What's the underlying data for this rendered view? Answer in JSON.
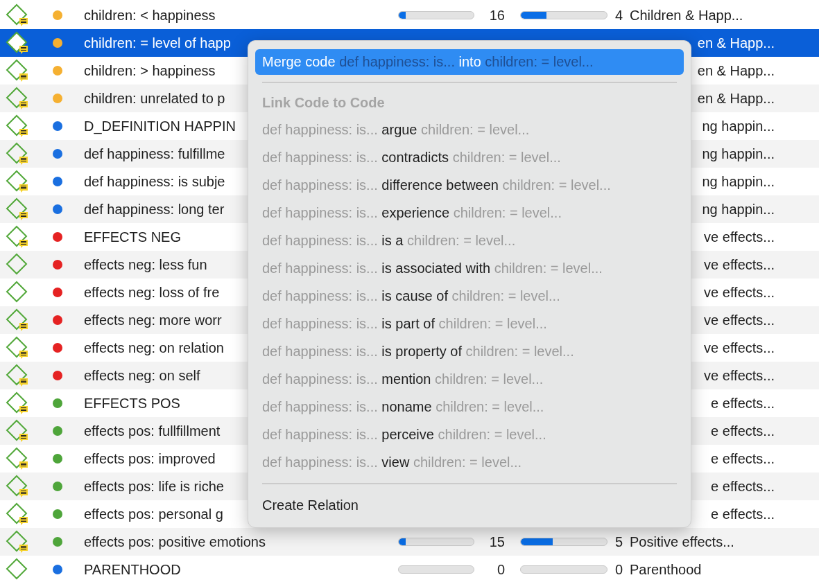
{
  "rows": [
    {
      "name": "children: < happiness",
      "color": "#f5b031",
      "memo": true,
      "selected": false,
      "frequency": {
        "count": "16",
        "level": 0.09
      },
      "memos": {
        "count": "4",
        "level": 0.3
      },
      "group": "Children & Happ..."
    },
    {
      "name": "children: = level of happ",
      "color": "#f5b031",
      "memo": true,
      "selected": true,
      "group": "en & Happ..."
    },
    {
      "name": "children: > happiness",
      "color": "#f5b031",
      "memo": true,
      "selected": false,
      "group": "en & Happ..."
    },
    {
      "name": "children: unrelated to p",
      "color": "#f5b031",
      "memo": true,
      "selected": false,
      "group": "en & Happ..."
    },
    {
      "name": "D_DEFINITION HAPPIN",
      "color": "#1a6fe0",
      "memo": true,
      "selected": false,
      "group": "ng happin..."
    },
    {
      "name": "def happiness: fulfillme",
      "color": "#1a6fe0",
      "memo": true,
      "selected": false,
      "group": "ng happin..."
    },
    {
      "name": "def happiness: is subje",
      "color": "#1a6fe0",
      "memo": true,
      "selected": false,
      "group": "ng happin..."
    },
    {
      "name": "def happiness: long ter",
      "color": "#1a6fe0",
      "memo": true,
      "selected": false,
      "group": "ng happin..."
    },
    {
      "name": "EFFECTS NEG",
      "color": "#e52222",
      "memo": true,
      "selected": false,
      "group": "ve effects..."
    },
    {
      "name": "effects neg: less fun",
      "color": "#e52222",
      "memo": false,
      "selected": false,
      "group": "ve effects..."
    },
    {
      "name": "effects neg: loss of fre",
      "color": "#e52222",
      "memo": false,
      "selected": false,
      "group": "ve effects..."
    },
    {
      "name": "effects neg: more worr",
      "color": "#e52222",
      "memo": true,
      "selected": false,
      "group": "ve effects..."
    },
    {
      "name": "effects neg: on relation",
      "color": "#e52222",
      "memo": true,
      "selected": false,
      "group": "ve effects..."
    },
    {
      "name": "effects neg: on self",
      "color": "#e52222",
      "memo": true,
      "selected": false,
      "group": "ve effects..."
    },
    {
      "name": "EFFECTS POS",
      "color": "#4ea53a",
      "memo": true,
      "selected": false,
      "group": "e effects..."
    },
    {
      "name": "effects pos: fullfillment",
      "color": "#4ea53a",
      "memo": true,
      "selected": false,
      "group": "e effects..."
    },
    {
      "name": "effects pos: improved",
      "color": "#4ea53a",
      "memo": true,
      "selected": false,
      "group": "e effects..."
    },
    {
      "name": "effects pos: life is riche",
      "color": "#4ea53a",
      "memo": true,
      "selected": false,
      "group": "e effects..."
    },
    {
      "name": "effects pos: personal g",
      "color": "#4ea53a",
      "memo": true,
      "selected": false,
      "group": "e effects..."
    },
    {
      "name": "effects pos: positive emotions",
      "color": "#4ea53a",
      "memo": true,
      "selected": false,
      "frequency": {
        "count": "15",
        "level": 0.09
      },
      "memos": {
        "count": "5",
        "level": 0.37
      },
      "group": "Positive effects..."
    },
    {
      "name": "PARENTHOOD",
      "color": "#1a6fe0",
      "memo": false,
      "selected": false,
      "frequency": {
        "count": "0"
      },
      "memos": {
        "count": "0"
      },
      "group": "Parenthood"
    }
  ],
  "context_menu": {
    "merge_item": {
      "label": "Merge code",
      "source": "def happiness: is...",
      "joiner": "into",
      "target": "children: = level...",
      "selected": true
    },
    "section_title": "Link Code to Code",
    "link_items": [
      {
        "source": "def happiness: is...",
        "relation": "argue",
        "target": "children: = level..."
      },
      {
        "source": "def happiness: is...",
        "relation": "contradicts",
        "target": "children: = level..."
      },
      {
        "source": "def happiness: is...",
        "relation": "difference between",
        "target": "children: = level..."
      },
      {
        "source": "def happiness: is...",
        "relation": "experience",
        "target": "children: = level..."
      },
      {
        "source": "def happiness: is...",
        "relation": "is a",
        "target": "children: = level..."
      },
      {
        "source": "def happiness: is...",
        "relation": "is associated with",
        "target": "children: = level..."
      },
      {
        "source": "def happiness: is...",
        "relation": "is cause of",
        "target": "children: = level..."
      },
      {
        "source": "def happiness: is...",
        "relation": "is part of",
        "target": "children: = level..."
      },
      {
        "source": "def happiness: is...",
        "relation": "is property of",
        "target": "children: = level..."
      },
      {
        "source": "def happiness: is...",
        "relation": "mention",
        "target": "children: = level..."
      },
      {
        "source": "def happiness: is...",
        "relation": "noname",
        "target": "children: = level..."
      },
      {
        "source": "def happiness: is...",
        "relation": "perceive",
        "target": "children: = level..."
      },
      {
        "source": "def happiness: is...",
        "relation": "view",
        "target": "children: = level..."
      }
    ],
    "create_item": "Create Relation"
  }
}
